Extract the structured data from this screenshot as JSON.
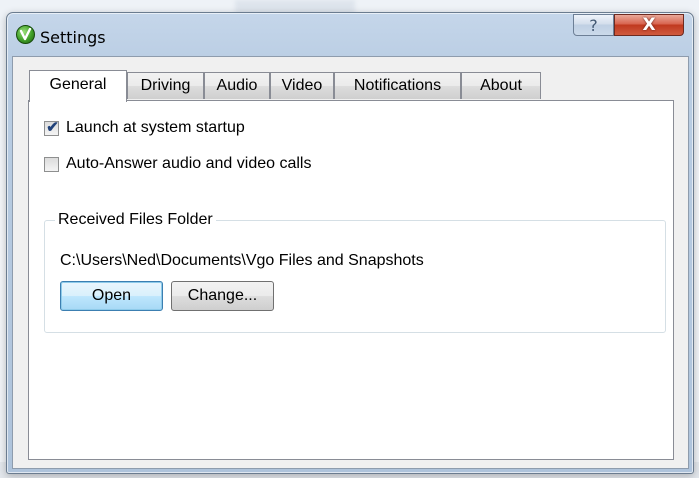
{
  "window": {
    "title": "Settings",
    "help_label": "?",
    "close_label": "X"
  },
  "tabs": [
    {
      "label": "General",
      "active": true
    },
    {
      "label": "Driving",
      "active": false
    },
    {
      "label": "Audio",
      "active": false
    },
    {
      "label": "Video",
      "active": false
    },
    {
      "label": "Notifications",
      "active": false
    },
    {
      "label": "About",
      "active": false
    }
  ],
  "general": {
    "launch_startup": {
      "label": "Launch at system startup",
      "checked": true,
      "mark": "✔"
    },
    "auto_answer": {
      "label": "Auto-Answer audio and video calls",
      "checked": false
    },
    "received_files": {
      "legend": "Received Files Folder",
      "path": "C:\\Users\\Ned\\Documents\\Vgo Files and Snapshots",
      "open_label": "Open",
      "change_label": "Change..."
    }
  },
  "colors": {
    "close_button": "#c7432a",
    "default_button": "#bee6fd",
    "frame": "#b9cde3"
  },
  "icons": {
    "app": "vgo-logo-icon",
    "help": "question-mark-icon",
    "close": "close-icon",
    "check": "checkmark-icon"
  }
}
